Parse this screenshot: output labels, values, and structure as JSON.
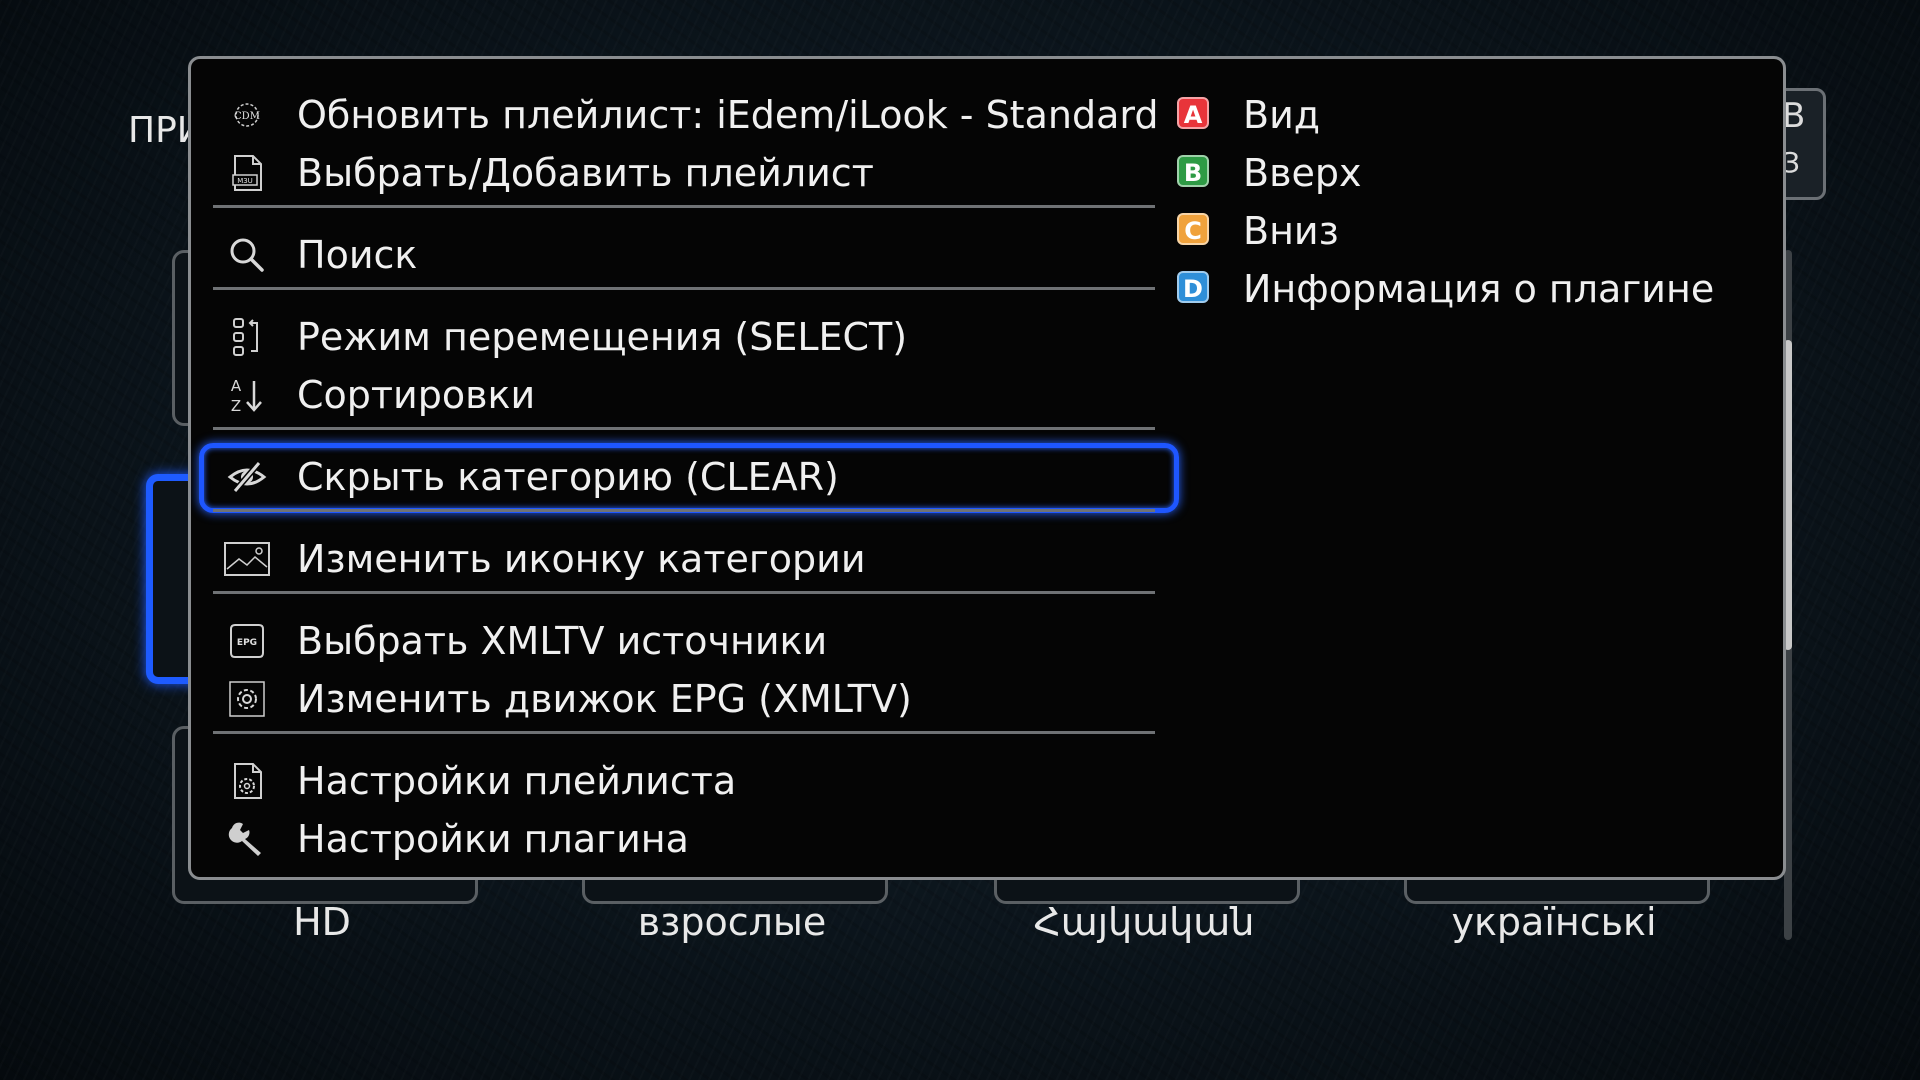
{
  "background": {
    "header_text": "ПРИ",
    "right_chars": [
      "В",
      "З"
    ],
    "category_labels": [
      "HD",
      "взрослые",
      "Հայկական",
      "українські"
    ]
  },
  "menu": {
    "items": [
      {
        "name": "refresh-playlist",
        "label": "Обновить плейлист: iEdem/iLook - Standard",
        "icon": "playlist-logo-icon"
      },
      {
        "name": "select-add-playlist",
        "label": "Выбрать/Добавить плейлист",
        "icon": "m3u-file-icon"
      },
      {
        "name": "search",
        "label": "Поиск",
        "icon": "search-icon"
      },
      {
        "name": "move-mode",
        "label": "Режим перемещения (SELECT)",
        "icon": "move-list-icon"
      },
      {
        "name": "sorting",
        "label": "Сортировки",
        "icon": "sort-az-icon"
      },
      {
        "name": "hide-category",
        "label": "Скрыть категорию (CLEAR)",
        "icon": "eye-slash-icon",
        "selected": true
      },
      {
        "name": "change-category-icon",
        "label": "Изменить иконку категории",
        "icon": "image-icon"
      },
      {
        "name": "select-xmltv-sources",
        "label": "Выбрать XMLTV источники",
        "icon": "epg-icon"
      },
      {
        "name": "change-epg-engine",
        "label": "Изменить движок EPG (XMLTV)",
        "icon": "gear-icon"
      },
      {
        "name": "playlist-settings",
        "label": "Настройки плейлиста",
        "icon": "file-gear-icon"
      },
      {
        "name": "plugin-settings",
        "label": "Настройки плагина",
        "icon": "wrench-icon"
      }
    ],
    "color_keys": [
      {
        "key": "A",
        "label": "Вид",
        "color": "#e8343a"
      },
      {
        "key": "B",
        "label": "Вверх",
        "color": "#2e9b45"
      },
      {
        "key": "C",
        "label": "Вниз",
        "color": "#f0a23c"
      },
      {
        "key": "D",
        "label": "Информация о плагине",
        "color": "#2f8fd8"
      }
    ]
  },
  "colors": {
    "selection": "#1e56ff",
    "popup_bg": "#050505"
  }
}
